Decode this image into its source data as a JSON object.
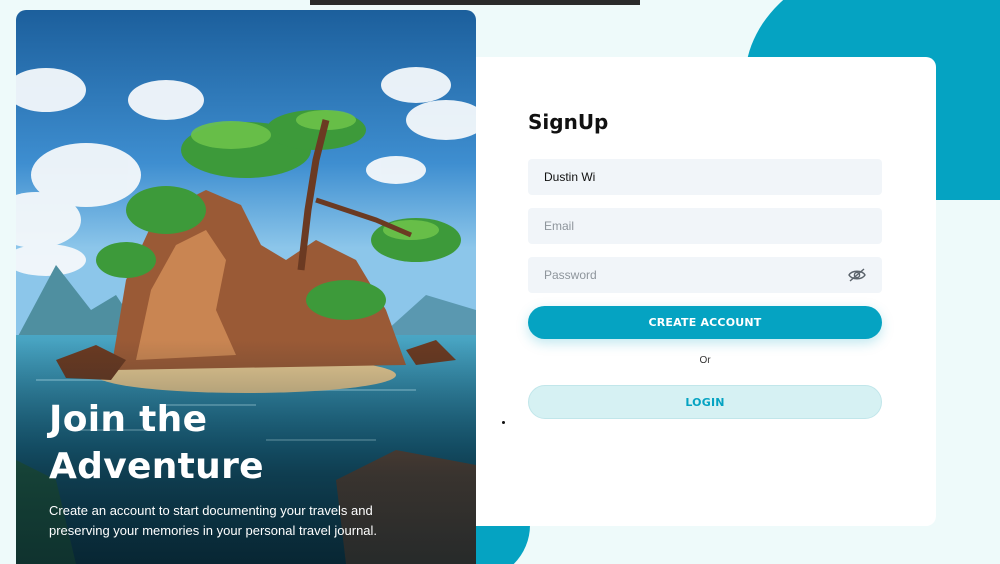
{
  "hero": {
    "title_line1": "Join the",
    "title_line2": "Adventure",
    "subtitle": "Create an account to start documenting your travels and preserving your memories in your personal travel journal."
  },
  "form": {
    "title": "SignUp",
    "name_value": "Dustin Wi",
    "email_placeholder": "Email",
    "password_placeholder": "Password",
    "create_label": "CREATE ACCOUNT",
    "or_label": "Or",
    "login_label": "LOGIN"
  },
  "colors": {
    "accent": "#05a3c2",
    "login_bg": "#d6f1f3",
    "input_bg": "#f1f5f9"
  },
  "icons": {
    "password_toggle": "eye-slash-icon"
  }
}
